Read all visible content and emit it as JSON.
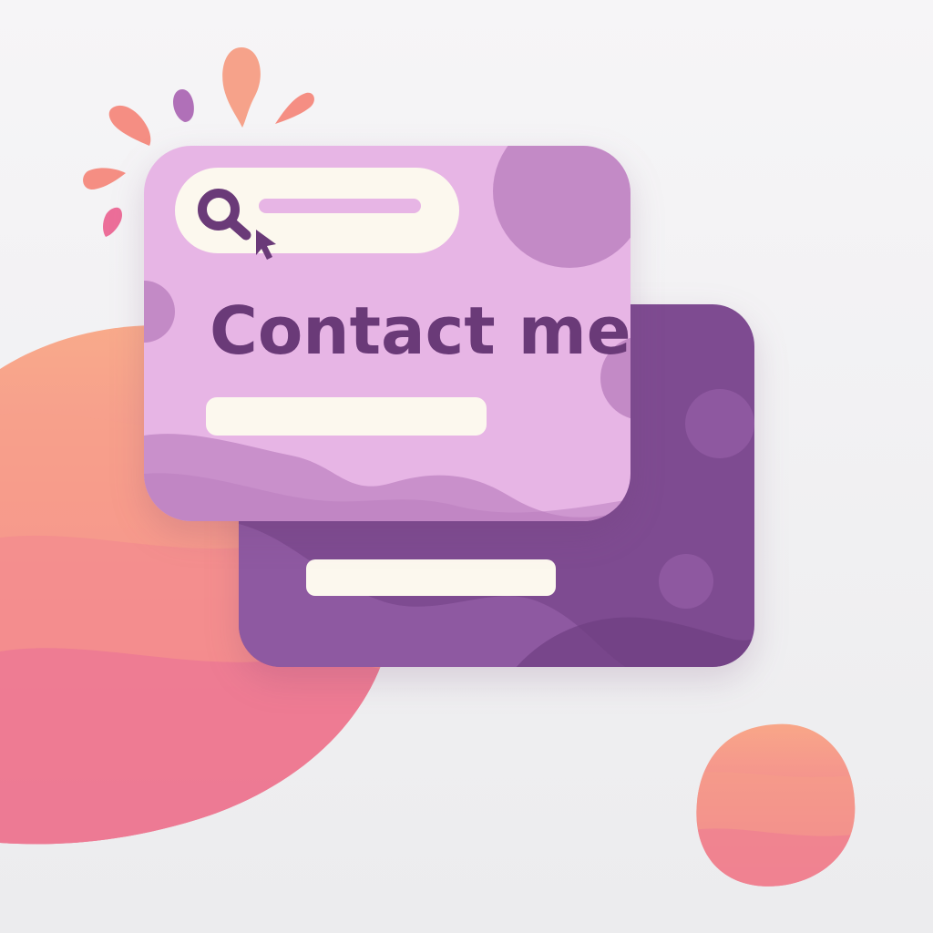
{
  "card": {
    "heading": "Contact me"
  },
  "search": {
    "icon": "search-icon",
    "cursor_icon": "cursor-arrow-icon"
  },
  "colors": {
    "front_card": "#e7b5e5",
    "back_card": "#7e4b91",
    "heading": "#6a3a78",
    "field": "#fcf8ee",
    "peach": "#f8a987",
    "pink": "#ec6e99",
    "accent_splash": "#f58e83",
    "accent_purple": "#b070b8"
  }
}
